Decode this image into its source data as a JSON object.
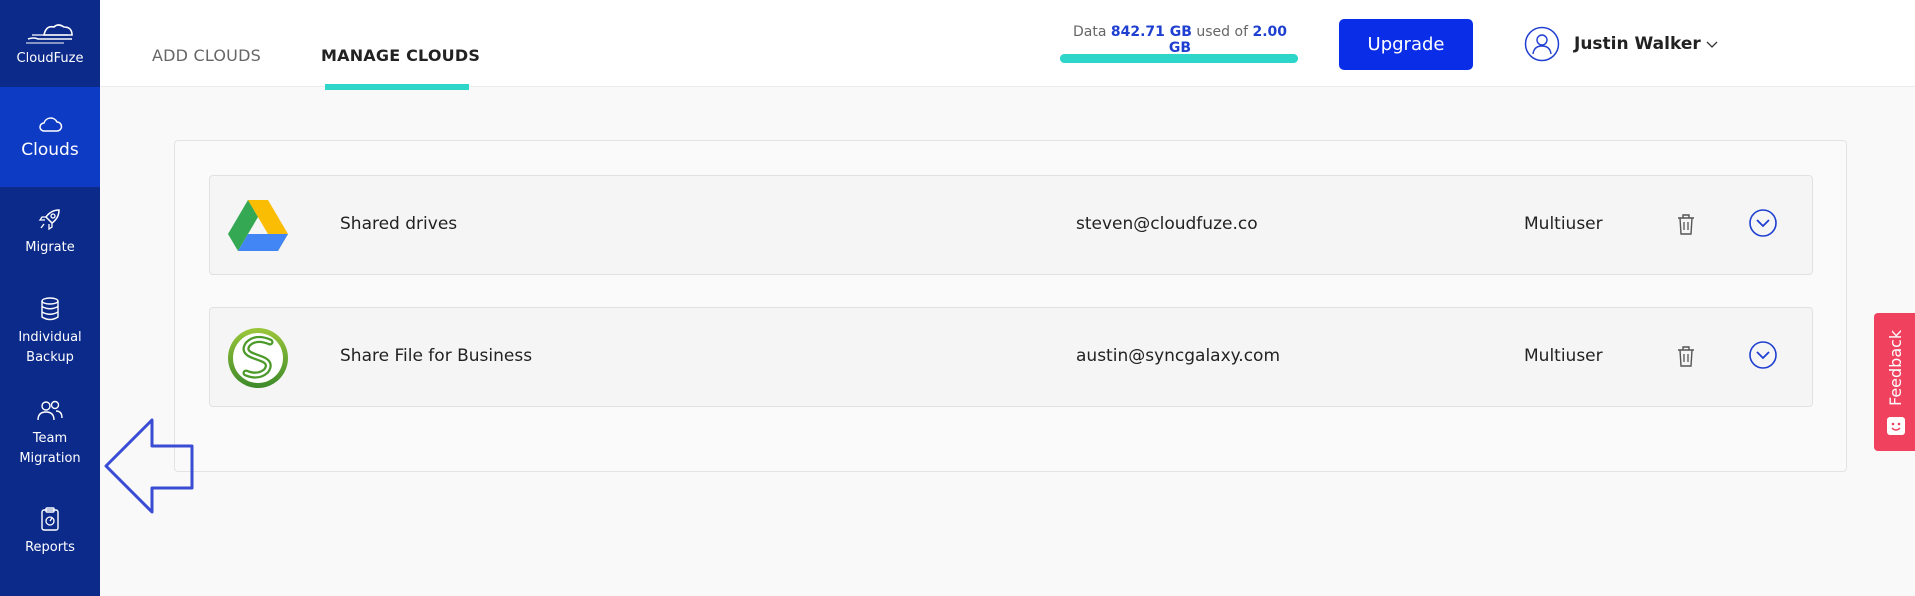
{
  "app": {
    "brand": "CloudFuze"
  },
  "sidebar": {
    "items": [
      {
        "label": "Clouds",
        "icon": "cloud-icon",
        "active": true
      },
      {
        "label": "Migrate",
        "icon": "rocket-icon",
        "active": false
      },
      {
        "label_line1": "Individual",
        "label_line2": "Backup",
        "icon": "database-icon",
        "active": false
      },
      {
        "label_line1": "Team",
        "label_line2": "Migration",
        "icon": "users-icon",
        "active": false
      },
      {
        "label": "Reports",
        "icon": "clipboard-report-icon",
        "active": false
      }
    ]
  },
  "header": {
    "tabs": [
      {
        "label": "ADD CLOUDS",
        "active": false
      },
      {
        "label": "MANAGE CLOUDS",
        "active": true
      }
    ],
    "quota": {
      "prefix": "Data",
      "used": "842.71 GB",
      "middle": "used of",
      "total": "2.00 GB"
    },
    "upgrade_label": "Upgrade",
    "user": {
      "name": "Justin Walker"
    }
  },
  "clouds": [
    {
      "name": "Shared drives",
      "email": "steven@cloudfuze.co",
      "type": "Multiuser",
      "logo": "google-drive-icon"
    },
    {
      "name": "Share File for Business",
      "email": "austin@syncgalaxy.com",
      "type": "Multiuser",
      "logo": "sharefile-icon"
    }
  ],
  "feedback": {
    "label": "Feedback"
  },
  "colors": {
    "sidebar_bg": "#0c2a8a",
    "sidebar_active": "#0e3bc4",
    "accent_teal": "#2dd6c8",
    "upgrade_blue": "#0a2de8",
    "feedback_red": "#f0425e"
  }
}
